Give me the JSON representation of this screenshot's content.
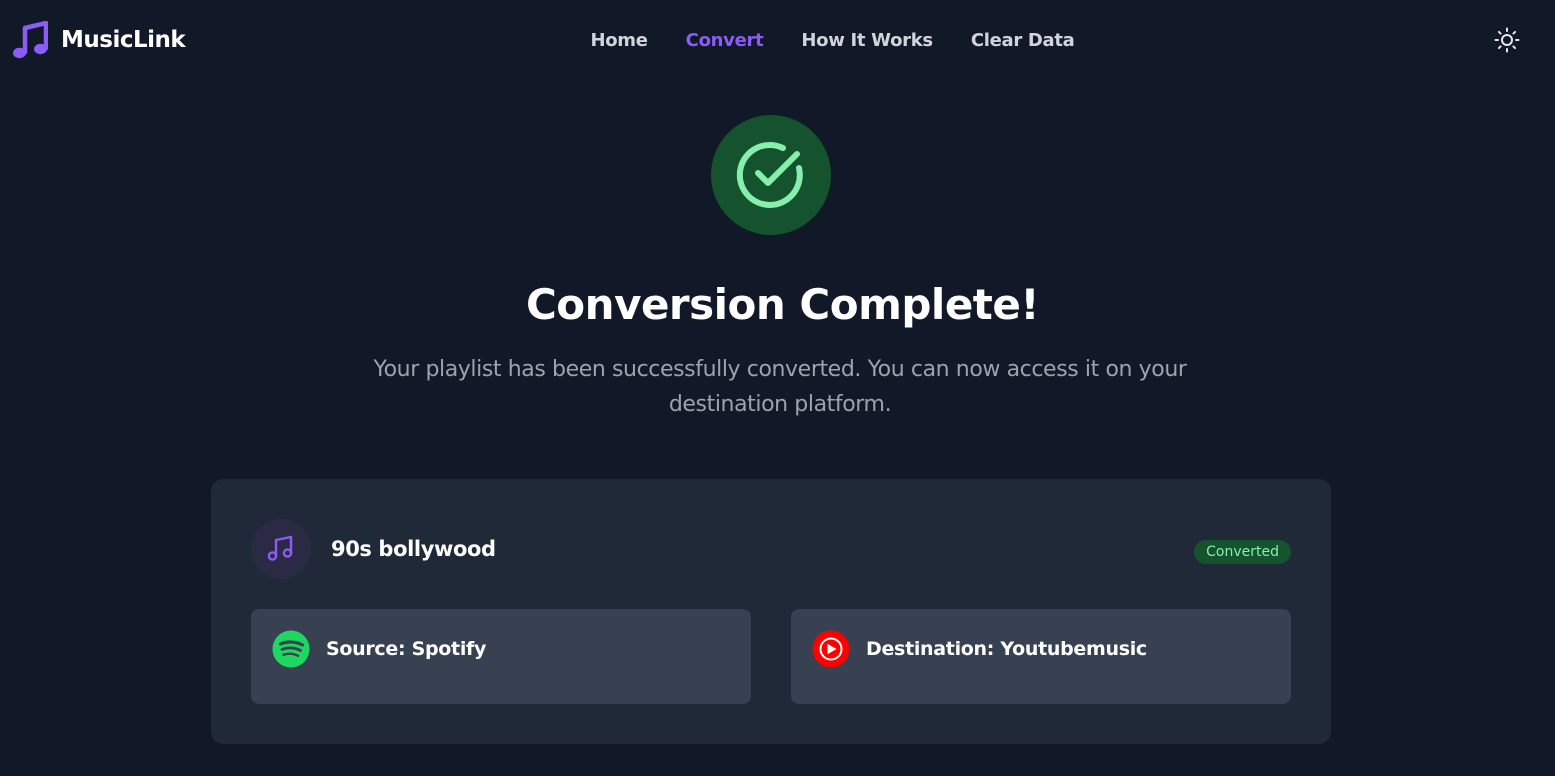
{
  "brand": {
    "name": "MusicLink",
    "icon": "music-note-icon",
    "color": "#8b5cf6"
  },
  "nav": {
    "items": [
      {
        "label": "Home",
        "active": false
      },
      {
        "label": "Convert",
        "active": true
      },
      {
        "label": "How It Works",
        "active": false
      },
      {
        "label": "Clear Data",
        "active": false
      }
    ],
    "theme_toggle_icon": "sun-icon"
  },
  "hero": {
    "icon": "check-circle-icon",
    "title": "Conversion Complete!",
    "subtitle": "Your playlist has been successfully converted. You can now access it on your destination platform."
  },
  "playlist": {
    "icon": "music-note-icon",
    "name": "90s bollywood",
    "status": "Converted",
    "source": {
      "label": "Source: Spotify",
      "icon": "spotify-icon",
      "color": "#1ed760"
    },
    "destination": {
      "label": "Destination: Youtubemusic",
      "icon": "youtube-music-icon",
      "color": "#ff0000"
    }
  },
  "colors": {
    "background": "#111827",
    "card": "#1f2937",
    "panel": "#374151",
    "accent": "#8b5cf6",
    "success_bg": "#14532d",
    "success_fg": "#86efac"
  }
}
